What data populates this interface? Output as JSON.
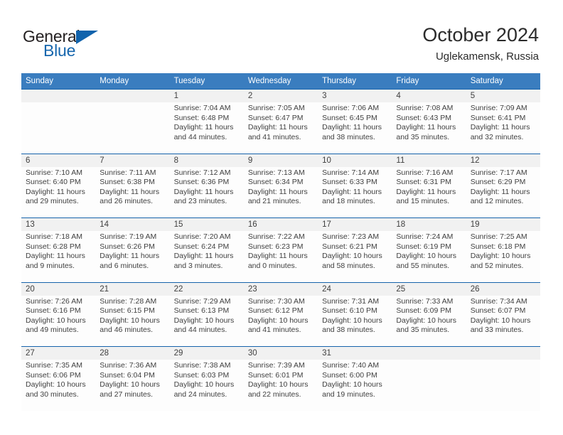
{
  "brand": {
    "name_part1": "General",
    "name_part2": "Blue",
    "triangle_icon": "triangle-icon",
    "accent_color": "#1163ac"
  },
  "header": {
    "title": "October 2024",
    "subtitle": "Uglekamensk, Russia"
  },
  "colors": {
    "header_row_bg": "#3a7dbf",
    "date_row_bg": "#f1f1f1",
    "week_divider": "#1663ab",
    "text": "#3f3f3f"
  },
  "weekday_headers": [
    "Sunday",
    "Monday",
    "Tuesday",
    "Wednesday",
    "Thursday",
    "Friday",
    "Saturday"
  ],
  "weeks": [
    {
      "days": [
        {
          "date": "",
          "sunrise": "",
          "sunset": "",
          "daylight_line1": "",
          "daylight_line2": ""
        },
        {
          "date": "",
          "sunrise": "",
          "sunset": "",
          "daylight_line1": "",
          "daylight_line2": ""
        },
        {
          "date": "1",
          "sunrise": "Sunrise: 7:04 AM",
          "sunset": "Sunset: 6:48 PM",
          "daylight_line1": "Daylight: 11 hours",
          "daylight_line2": "and 44 minutes."
        },
        {
          "date": "2",
          "sunrise": "Sunrise: 7:05 AM",
          "sunset": "Sunset: 6:47 PM",
          "daylight_line1": "Daylight: 11 hours",
          "daylight_line2": "and 41 minutes."
        },
        {
          "date": "3",
          "sunrise": "Sunrise: 7:06 AM",
          "sunset": "Sunset: 6:45 PM",
          "daylight_line1": "Daylight: 11 hours",
          "daylight_line2": "and 38 minutes."
        },
        {
          "date": "4",
          "sunrise": "Sunrise: 7:08 AM",
          "sunset": "Sunset: 6:43 PM",
          "daylight_line1": "Daylight: 11 hours",
          "daylight_line2": "and 35 minutes."
        },
        {
          "date": "5",
          "sunrise": "Sunrise: 7:09 AM",
          "sunset": "Sunset: 6:41 PM",
          "daylight_line1": "Daylight: 11 hours",
          "daylight_line2": "and 32 minutes."
        }
      ]
    },
    {
      "days": [
        {
          "date": "6",
          "sunrise": "Sunrise: 7:10 AM",
          "sunset": "Sunset: 6:40 PM",
          "daylight_line1": "Daylight: 11 hours",
          "daylight_line2": "and 29 minutes."
        },
        {
          "date": "7",
          "sunrise": "Sunrise: 7:11 AM",
          "sunset": "Sunset: 6:38 PM",
          "daylight_line1": "Daylight: 11 hours",
          "daylight_line2": "and 26 minutes."
        },
        {
          "date": "8",
          "sunrise": "Sunrise: 7:12 AM",
          "sunset": "Sunset: 6:36 PM",
          "daylight_line1": "Daylight: 11 hours",
          "daylight_line2": "and 23 minutes."
        },
        {
          "date": "9",
          "sunrise": "Sunrise: 7:13 AM",
          "sunset": "Sunset: 6:34 PM",
          "daylight_line1": "Daylight: 11 hours",
          "daylight_line2": "and 21 minutes."
        },
        {
          "date": "10",
          "sunrise": "Sunrise: 7:14 AM",
          "sunset": "Sunset: 6:33 PM",
          "daylight_line1": "Daylight: 11 hours",
          "daylight_line2": "and 18 minutes."
        },
        {
          "date": "11",
          "sunrise": "Sunrise: 7:16 AM",
          "sunset": "Sunset: 6:31 PM",
          "daylight_line1": "Daylight: 11 hours",
          "daylight_line2": "and 15 minutes."
        },
        {
          "date": "12",
          "sunrise": "Sunrise: 7:17 AM",
          "sunset": "Sunset: 6:29 PM",
          "daylight_line1": "Daylight: 11 hours",
          "daylight_line2": "and 12 minutes."
        }
      ]
    },
    {
      "days": [
        {
          "date": "13",
          "sunrise": "Sunrise: 7:18 AM",
          "sunset": "Sunset: 6:28 PM",
          "daylight_line1": "Daylight: 11 hours",
          "daylight_line2": "and 9 minutes."
        },
        {
          "date": "14",
          "sunrise": "Sunrise: 7:19 AM",
          "sunset": "Sunset: 6:26 PM",
          "daylight_line1": "Daylight: 11 hours",
          "daylight_line2": "and 6 minutes."
        },
        {
          "date": "15",
          "sunrise": "Sunrise: 7:20 AM",
          "sunset": "Sunset: 6:24 PM",
          "daylight_line1": "Daylight: 11 hours",
          "daylight_line2": "and 3 minutes."
        },
        {
          "date": "16",
          "sunrise": "Sunrise: 7:22 AM",
          "sunset": "Sunset: 6:23 PM",
          "daylight_line1": "Daylight: 11 hours",
          "daylight_line2": "and 0 minutes."
        },
        {
          "date": "17",
          "sunrise": "Sunrise: 7:23 AM",
          "sunset": "Sunset: 6:21 PM",
          "daylight_line1": "Daylight: 10 hours",
          "daylight_line2": "and 58 minutes."
        },
        {
          "date": "18",
          "sunrise": "Sunrise: 7:24 AM",
          "sunset": "Sunset: 6:19 PM",
          "daylight_line1": "Daylight: 10 hours",
          "daylight_line2": "and 55 minutes."
        },
        {
          "date": "19",
          "sunrise": "Sunrise: 7:25 AM",
          "sunset": "Sunset: 6:18 PM",
          "daylight_line1": "Daylight: 10 hours",
          "daylight_line2": "and 52 minutes."
        }
      ]
    },
    {
      "days": [
        {
          "date": "20",
          "sunrise": "Sunrise: 7:26 AM",
          "sunset": "Sunset: 6:16 PM",
          "daylight_line1": "Daylight: 10 hours",
          "daylight_line2": "and 49 minutes."
        },
        {
          "date": "21",
          "sunrise": "Sunrise: 7:28 AM",
          "sunset": "Sunset: 6:15 PM",
          "daylight_line1": "Daylight: 10 hours",
          "daylight_line2": "and 46 minutes."
        },
        {
          "date": "22",
          "sunrise": "Sunrise: 7:29 AM",
          "sunset": "Sunset: 6:13 PM",
          "daylight_line1": "Daylight: 10 hours",
          "daylight_line2": "and 44 minutes."
        },
        {
          "date": "23",
          "sunrise": "Sunrise: 7:30 AM",
          "sunset": "Sunset: 6:12 PM",
          "daylight_line1": "Daylight: 10 hours",
          "daylight_line2": "and 41 minutes."
        },
        {
          "date": "24",
          "sunrise": "Sunrise: 7:31 AM",
          "sunset": "Sunset: 6:10 PM",
          "daylight_line1": "Daylight: 10 hours",
          "daylight_line2": "and 38 minutes."
        },
        {
          "date": "25",
          "sunrise": "Sunrise: 7:33 AM",
          "sunset": "Sunset: 6:09 PM",
          "daylight_line1": "Daylight: 10 hours",
          "daylight_line2": "and 35 minutes."
        },
        {
          "date": "26",
          "sunrise": "Sunrise: 7:34 AM",
          "sunset": "Sunset: 6:07 PM",
          "daylight_line1": "Daylight: 10 hours",
          "daylight_line2": "and 33 minutes."
        }
      ]
    },
    {
      "days": [
        {
          "date": "27",
          "sunrise": "Sunrise: 7:35 AM",
          "sunset": "Sunset: 6:06 PM",
          "daylight_line1": "Daylight: 10 hours",
          "daylight_line2": "and 30 minutes."
        },
        {
          "date": "28",
          "sunrise": "Sunrise: 7:36 AM",
          "sunset": "Sunset: 6:04 PM",
          "daylight_line1": "Daylight: 10 hours",
          "daylight_line2": "and 27 minutes."
        },
        {
          "date": "29",
          "sunrise": "Sunrise: 7:38 AM",
          "sunset": "Sunset: 6:03 PM",
          "daylight_line1": "Daylight: 10 hours",
          "daylight_line2": "and 24 minutes."
        },
        {
          "date": "30",
          "sunrise": "Sunrise: 7:39 AM",
          "sunset": "Sunset: 6:01 PM",
          "daylight_line1": "Daylight: 10 hours",
          "daylight_line2": "and 22 minutes."
        },
        {
          "date": "31",
          "sunrise": "Sunrise: 7:40 AM",
          "sunset": "Sunset: 6:00 PM",
          "daylight_line1": "Daylight: 10 hours",
          "daylight_line2": "and 19 minutes."
        },
        {
          "date": "",
          "sunrise": "",
          "sunset": "",
          "daylight_line1": "",
          "daylight_line2": ""
        },
        {
          "date": "",
          "sunrise": "",
          "sunset": "",
          "daylight_line1": "",
          "daylight_line2": ""
        }
      ]
    }
  ]
}
